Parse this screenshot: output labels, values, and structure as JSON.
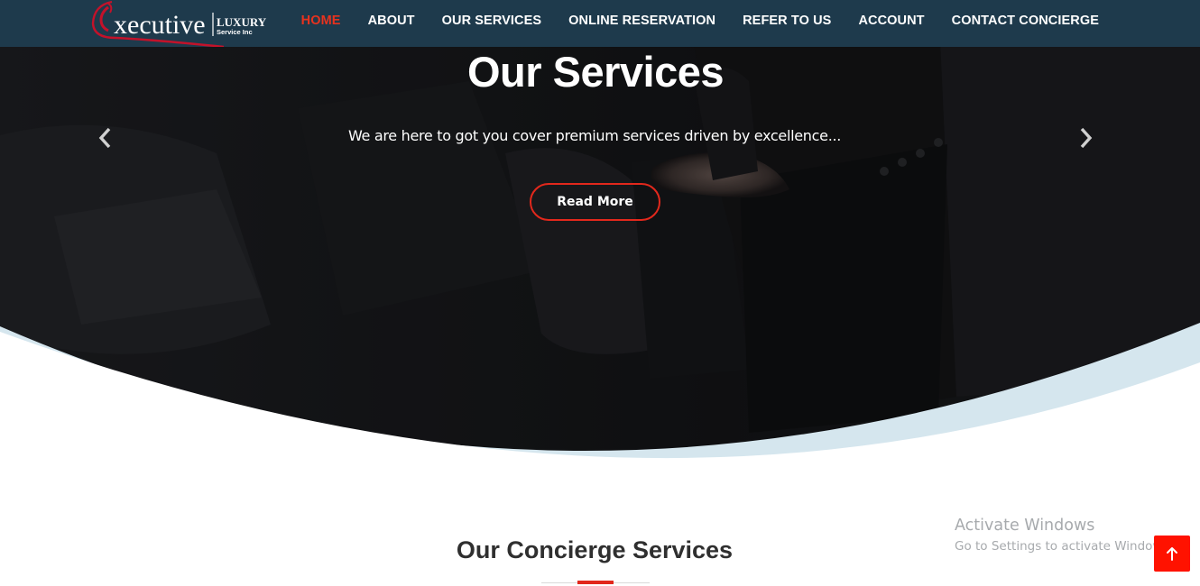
{
  "brand": {
    "logo_text_main": "xecutive",
    "logo_text_luxury": "LUXURY",
    "logo_text_service": "Service Inc",
    "accent_color": "#e2281c",
    "navbar_color": "#1e3a4c"
  },
  "nav": {
    "items": [
      {
        "label": "HOME",
        "active": true
      },
      {
        "label": "ABOUT"
      },
      {
        "label": "OUR SERVICES"
      },
      {
        "label": "ONLINE RESERVATION"
      },
      {
        "label": "REFER TO US"
      },
      {
        "label": "ACCOUNT"
      },
      {
        "label": "CONTACT CONCIERGE"
      }
    ]
  },
  "hero": {
    "title": "Our Services",
    "subtitle": "We are here to got you cover premium services driven by excellence...",
    "button_label": "Read More",
    "prev_icon": "chevron-left-icon",
    "next_icon": "chevron-right-icon"
  },
  "section": {
    "title": "Our Concierge Services"
  },
  "watermark": {
    "title": "Activate Windows",
    "subtitle": "Go to Settings to activate Windows."
  },
  "back_to_top": {
    "icon": "arrow-up-icon",
    "color": "#ff1200"
  }
}
